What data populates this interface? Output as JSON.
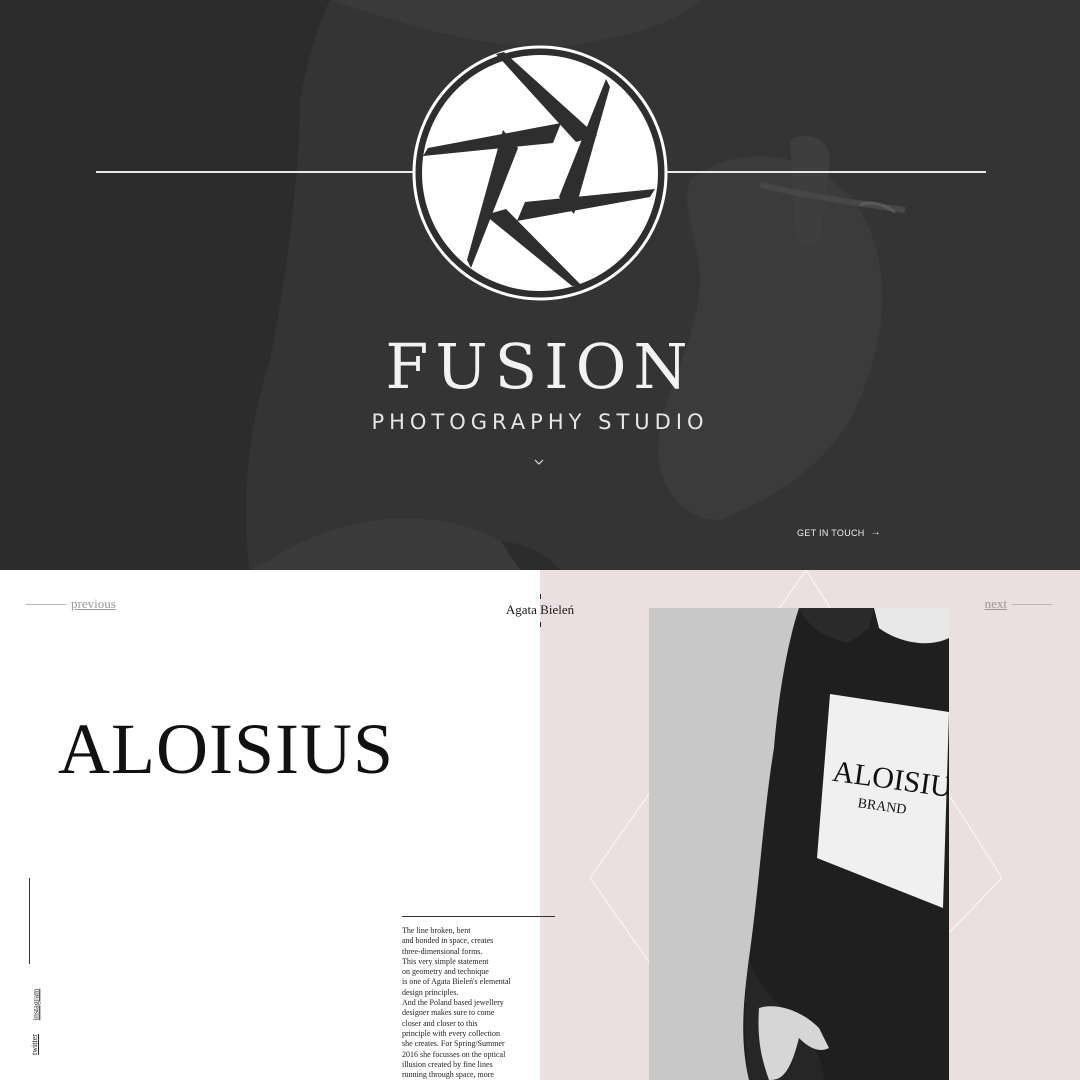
{
  "hero": {
    "brand_title": "FUSION",
    "brand_subtitle": "PHOTOGRAPHY STUDIO",
    "cta_label": "GET IN TOUCH",
    "cta_arrow": "→",
    "logo_icon": "camera-aperture-icon",
    "chevron_icon": "chevron-down-icon",
    "background_color": "#2e2e2e"
  },
  "project": {
    "nav": {
      "previous_label": "previous",
      "next_label": "next"
    },
    "author": "Agata Bieleń",
    "title": "ALOISIUS",
    "social": {
      "instagram": "instagram",
      "twitter": "twitter"
    },
    "description_lines": [
      "The line broken, bent",
      "and bonded in space, creates",
      "three-dimensional forms.",
      "This very simple statement",
      "on geometry and technique",
      "is one of Agata Bieleń's elemental",
      "design principles.",
      "And the Poland based jewellery",
      "designer makes sure to come",
      "closer and closer  to this",
      "principle with every collection",
      "she creates. For Spring/Summer",
      "2016 she focusses on the optical",
      "illusion created by fine lines",
      "running through space, more"
    ],
    "shirt_print": {
      "line1": "ALOISIUS",
      "line2": "BRAND"
    },
    "accent_pink": "#ecdfdf"
  }
}
